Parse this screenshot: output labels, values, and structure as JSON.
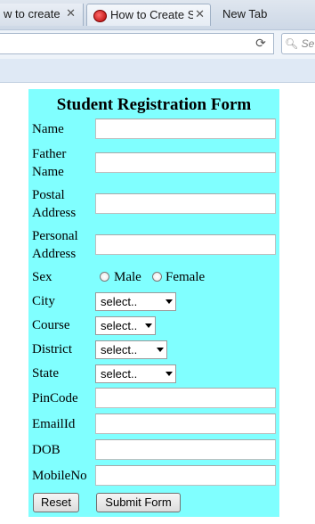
{
  "browser": {
    "tabs": [
      {
        "title": "w to create ap",
        "active": false
      },
      {
        "title": "How to Create St",
        "active": true
      },
      {
        "title": "New Tab",
        "active": false
      }
    ],
    "tab_close_glyph": "✕",
    "reload_glyph": "⟳",
    "search_placeholder": "Se"
  },
  "form": {
    "title": "Student Registration Form",
    "background": "#80ffff",
    "fields": {
      "name": {
        "label": "Name",
        "value": ""
      },
      "father_name": {
        "label_line1": "Father",
        "label_line2": "Name",
        "value": ""
      },
      "postal_address": {
        "label_line1": "Postal",
        "label_line2": "Address",
        "value": ""
      },
      "personal_address": {
        "label_line1": "Personal",
        "label_line2": "Address",
        "value": ""
      },
      "sex": {
        "label": "Sex",
        "options": [
          "Male",
          "Female"
        ],
        "selected": null
      },
      "city": {
        "label": "City",
        "selected": "select.."
      },
      "course": {
        "label": "Course",
        "selected": "select.."
      },
      "district": {
        "label": "District",
        "selected": "select.."
      },
      "state": {
        "label": "State",
        "selected": "select.."
      },
      "pincode": {
        "label": "PinCode",
        "value": ""
      },
      "email": {
        "label": "EmailId",
        "value": ""
      },
      "dob": {
        "label": "DOB",
        "value": ""
      },
      "mobile": {
        "label": "MobileNo",
        "value": ""
      }
    },
    "buttons": {
      "reset": "Reset",
      "submit": "Submit Form"
    }
  }
}
